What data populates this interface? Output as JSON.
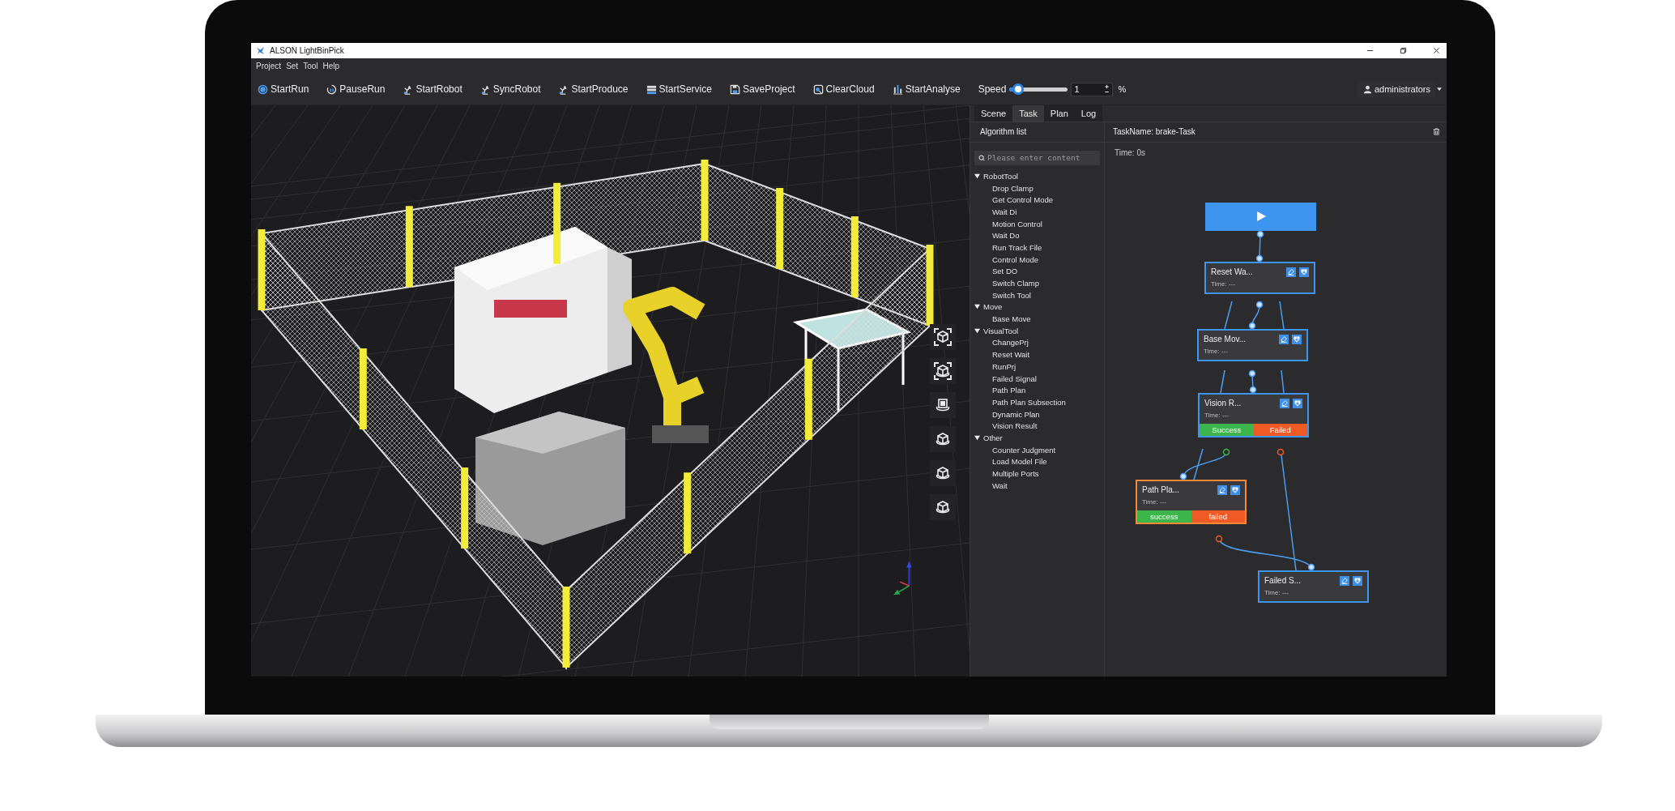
{
  "window": {
    "title": "ALSON LightBinPick"
  },
  "menu": [
    "Project",
    "Set",
    "Tool",
    "Help"
  ],
  "toolbar": [
    {
      "label": "StartRun",
      "kind": "circle"
    },
    {
      "label": "PauseRun",
      "kind": "pause"
    },
    {
      "label": "StartRobot",
      "kind": "robot"
    },
    {
      "label": "SyncRobot",
      "kind": "robot"
    },
    {
      "label": "StartProduce",
      "kind": "robot"
    },
    {
      "label": "StartService",
      "kind": "server"
    },
    {
      "label": "SaveProject",
      "kind": "save"
    },
    {
      "label": "ClearCloud",
      "kind": "cloud"
    },
    {
      "label": "StartAnalyse",
      "kind": "chart"
    }
  ],
  "speed": {
    "label": "Speed",
    "level": 0.15,
    "value": "1",
    "unit": "%"
  },
  "user": {
    "name": "administrators"
  },
  "tabs": [
    {
      "label": "Scene",
      "selected": false
    },
    {
      "label": "Task",
      "selected": true
    },
    {
      "label": "Plan",
      "selected": false
    },
    {
      "label": "Log",
      "selected": false
    }
  ],
  "algorithm_list": {
    "title": "Algorithm list",
    "search": {
      "placeholder": "Please enter content"
    },
    "groups": [
      {
        "label": "RobotTool",
        "expanded": true,
        "children": [
          {
            "label": "Drop Clamp"
          },
          {
            "label": "Get Control Mode"
          },
          {
            "label": "Wait Di"
          },
          {
            "label": "Motion Control"
          },
          {
            "label": "Wait Do"
          },
          {
            "label": "Run Track File"
          },
          {
            "label": "Control Mode"
          },
          {
            "label": "Set DO"
          },
          {
            "label": "Switch Clamp"
          },
          {
            "label": "Switch Tool"
          }
        ]
      },
      {
        "label": "Move",
        "expanded": true,
        "children": [
          {
            "label": "Base Move"
          }
        ]
      },
      {
        "label": "VisualTool",
        "expanded": true,
        "children": [
          {
            "label": "ChangePrj"
          },
          {
            "label": "Reset Wait"
          },
          {
            "label": "RunPrj"
          },
          {
            "label": "Failed Signal"
          },
          {
            "label": "Path Plan"
          },
          {
            "label": "Path Plan Subsection"
          },
          {
            "label": "Dynamic Plan"
          },
          {
            "label": "Vision Result"
          }
        ]
      },
      {
        "label": "Other",
        "expanded": true,
        "children": [
          {
            "label": "Counter Judgment"
          },
          {
            "label": "Load Model File"
          },
          {
            "label": "Multiple Ports"
          },
          {
            "label": "Wait"
          }
        ]
      }
    ]
  },
  "task": {
    "name": "TaskName: brake-Task",
    "time": "Time: 0s",
    "nodes": [
      {
        "kind": "start"
      },
      {
        "kind": "task",
        "title": "Reset Wa...",
        "time": "Time: ---",
        "selected": false
      },
      {
        "kind": "task",
        "title": "Base Mov...",
        "time": "Time: ---",
        "selected": false
      },
      {
        "kind": "task",
        "title": "Vision R...",
        "time": "Time: ---",
        "selected": false,
        "outcomes": [
          {
            "label": "Success",
            "kind": "success"
          },
          {
            "label": "Failed",
            "kind": "failed"
          }
        ]
      },
      {
        "kind": "task",
        "title": "Path Pla...",
        "time": "Time: ---",
        "selected": true,
        "outcomes": [
          {
            "label": "success",
            "kind": "success"
          },
          {
            "label": "failed",
            "kind": "failed"
          }
        ]
      },
      {
        "kind": "task",
        "title": "Failed S...",
        "time": "Time: ---",
        "selected": false
      }
    ]
  }
}
